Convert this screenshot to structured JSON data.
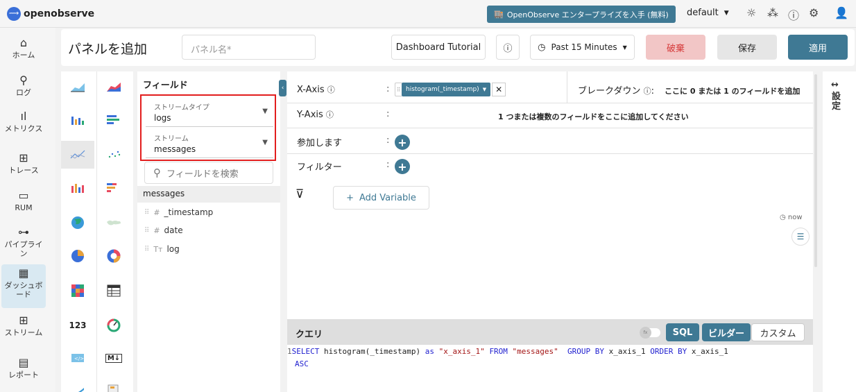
{
  "app": {
    "logo_text": "openobserve",
    "enterprise_label": "OpenObserve エンタープライズを入手 (無料)",
    "org": "default"
  },
  "nav": {
    "home": "ホーム",
    "logs": "ログ",
    "metrics": "メトリクス",
    "traces": "トレース",
    "rum": "RUM",
    "pipeline": "パイプライン",
    "dashboard": "ダッシュボード",
    "streams": "ストリーム",
    "reports": "レポート"
  },
  "header": {
    "title": "パネルを追加",
    "panel_name_placeholder": "パネル名*",
    "tutorial": "Dashboard Tutorial",
    "time_range": "Past 15 Minutes",
    "discard": "破棄",
    "save": "保存",
    "apply": "適用"
  },
  "fields": {
    "title": "フィールド",
    "stream_type_label": "ストリームタイプ",
    "stream_type_value": "logs",
    "stream_label": "ストリーム",
    "stream_value": "messages",
    "search_placeholder": "フィールドを検索",
    "stream_name": "messages",
    "items": [
      {
        "type": "#",
        "name": "_timestamp"
      },
      {
        "type": "#",
        "name": "date"
      },
      {
        "type": "Tт",
        "name": "log"
      }
    ]
  },
  "config": {
    "xaxis_label": "X-Axis",
    "xaxis_chip": "histogram(_timestamp)",
    "breakdown_label": "ブレークダウン",
    "breakdown_hint": "ここに 0 または 1 のフィールドを追加",
    "yaxis_label": "Y-Axis",
    "yaxis_hint": "1 つまたは複数のフィールドをここに追加してください",
    "join_label": "参加します",
    "filter_label": "フィルター",
    "add_variable": "Add Variable",
    "time_label": "now",
    "colon": ":"
  },
  "query": {
    "title": "クエリ",
    "mode_sql": "SQL",
    "mode_builder": "ビルダー",
    "mode_custom": "カスタム",
    "line_no": "1",
    "sql_parts": {
      "select": "SELECT",
      "fn": " histogram(_timestamp) ",
      "as": "as",
      "alias": " \"x_axis_1\" ",
      "from": "FROM",
      "table": " \"messages\"  ",
      "group_by": "GROUP BY",
      "g_col": " x_axis_1 ",
      "order_by": "ORDER BY",
      "o_col": " x_axis_1",
      "asc": "ASC"
    }
  },
  "settings": {
    "label": "設定"
  },
  "colors": {
    "accent": "#3f7994",
    "discard_bg": "#f2c6c6",
    "highlight": "#e21d1d"
  }
}
